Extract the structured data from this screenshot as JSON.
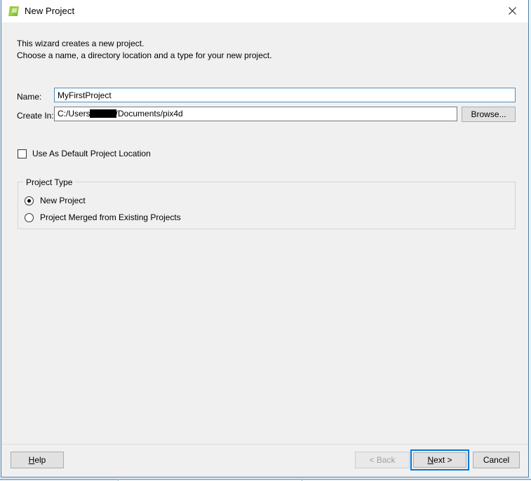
{
  "window": {
    "title": "New Project",
    "icon": "pix4d-logo-icon",
    "close_label": "✕"
  },
  "intro": {
    "line1": "This wizard creates a new project.",
    "line2": "Choose a name, a directory location and a type for your new project."
  },
  "form": {
    "name": {
      "label": "Name:",
      "value": "MyFirstProject",
      "placeholder": ""
    },
    "create_in": {
      "label": "Create In:",
      "value_prefix": "C:/Users",
      "value_redacted": true,
      "value_suffix": "/Documents/pix4d",
      "full_value": "C:/Users████/Documents/pix4d",
      "browse_label": "Browse..."
    },
    "use_default_location": {
      "label": "Use As Default Project Location",
      "checked": false
    }
  },
  "project_type": {
    "group_title": "Project Type",
    "options": [
      {
        "label": "New Project",
        "selected": true
      },
      {
        "label": "Project Merged from Existing Projects",
        "selected": false
      }
    ]
  },
  "footer": {
    "help": {
      "label_pre": "H",
      "label_post": "elp",
      "enabled": true
    },
    "back": {
      "label": "< Back",
      "enabled": false
    },
    "next": {
      "label_pre": "N",
      "label_post": "ext >",
      "enabled": true,
      "default": true
    },
    "cancel": {
      "label": "Cancel",
      "enabled": true
    }
  },
  "colors": {
    "dialog_background": "#f0f0f0",
    "dialog_border": "#4a7ba7",
    "focus_accent": "#0078d7",
    "input_focus_border": "#4a90c4",
    "brand_green": "#8dc63f",
    "disabled_text": "#a0a0a0"
  }
}
